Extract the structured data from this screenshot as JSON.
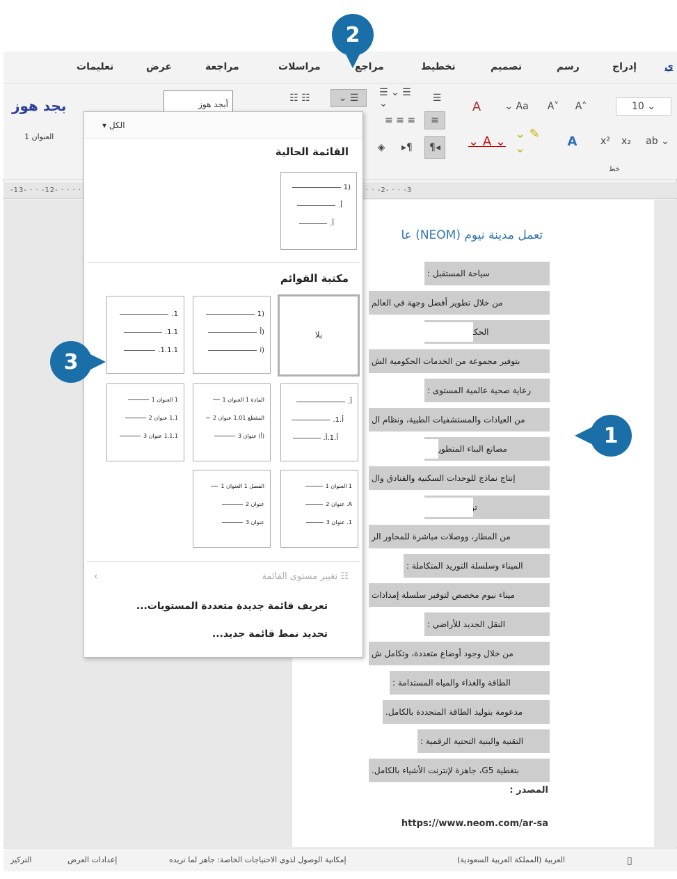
{
  "tabs": [
    "ي",
    "إدراج",
    "رسم",
    "تصميم",
    "تخطيط",
    "مراجع",
    "مراسلات",
    "مراجعة",
    "عرض",
    "تعليمات"
  ],
  "ribbon": {
    "font_size": "10",
    "styles_preview_1": "بجد هوز",
    "styles_preview_2": "أبجد هوز",
    "styles_caption": "العنوان 1",
    "group_font": "خط"
  },
  "ruler": "-13- · · -12- · · · · · · · · · · · · · · · · · · · · · · · · · · · · · -4- · · -3- · · -2- · · -1- · · · · · -1- · · -2- · · -3",
  "document": {
    "heading": "تعمل مدينة نيوم (NEOM) عا",
    "lines": [
      "سياحة المستقبل :",
      "من خلال تطوير أفضل وجهة في العالم",
      "الحكومة الرقمية :",
      "بتوفير مجموعة من الخدمات الحكومية الش",
      "رعاية صحية عالمية المستوى :",
      "من العيادات والمستشفيات الطبية، ونظام ال",
      "مصانع البناء المتطورة :",
      "إنتاج نماذج للوحدات السكنية والفنادق وال",
      "توصيل الهواء :",
      "من المطار، ووصلات مباشرة للمحاور الر",
      "الميناء وسلسلة التوريد المتكاملة :",
      "ميناء نيوم مخصص لتوفير سلسلة إمدادات",
      "النقل الجديد للأراضي :",
      "من خلال وجود أوضاع متعددة، وتكامل ش",
      "الطاقة والغذاء والمياه المستدامة :",
      "مدعومة بتوليد الطاقة المتجددة بالكامل.",
      "التقنية والبنية التحتية الرقمية :",
      "بتغطية G5، جاهزة لإنترنت الأشياء بالكامل."
    ],
    "source_label": "المصدر :",
    "source_url": "https://www.neom.com/ar-sa"
  },
  "dropdown": {
    "filter": "الكل",
    "current_list_title": "القائمة الحالية",
    "current_list_items": [
      "(1",
      "أ.",
      "أ."
    ],
    "library_title": "مكتبة القوائم",
    "none_label": "بلا",
    "list_a": [
      "(1",
      "(أ",
      "(i"
    ],
    "list_b": [
      "1.",
      "1.1.",
      "1.1.1."
    ],
    "list_c": [
      "أ.",
      "أ.1.",
      "أ.1.أ."
    ],
    "list_d": [
      "المادة 1 العنوان 1",
      "المقطع 1.01 عنوان 2",
      "(أ) عنوان 3"
    ],
    "list_e": [
      "1 العنوان 1",
      "1.1 عنوان 2",
      "1.1.1 عنوان 3"
    ],
    "list_f": [
      "1 العنوان 1",
      "A. عنوان 2",
      "1. عنوان 3"
    ],
    "list_g": [
      "الفصل 1 العنوان 1",
      "عنوان 2",
      "عنوان 3"
    ],
    "change_level": "تغيير مستوى القائمة",
    "define_multilevel": "تعريف قائمة جديدة متعددة المستويات...",
    "define_style": "تحديد نمط قائمة جديد..."
  },
  "status": {
    "language": "العربية (المملكة العربية السعودية)",
    "accessibility": "إمكانية الوصول لذوي الاحتياجات الخاصة: جاهز لما تريده",
    "display_settings": "إعدادات العرض",
    "focus": "التركيز"
  },
  "callouts": [
    "1",
    "2",
    "3"
  ],
  "colors": {
    "badge": "#1a6fa8",
    "heading": "#2e75b6",
    "highlight": "#cdcdcd"
  }
}
